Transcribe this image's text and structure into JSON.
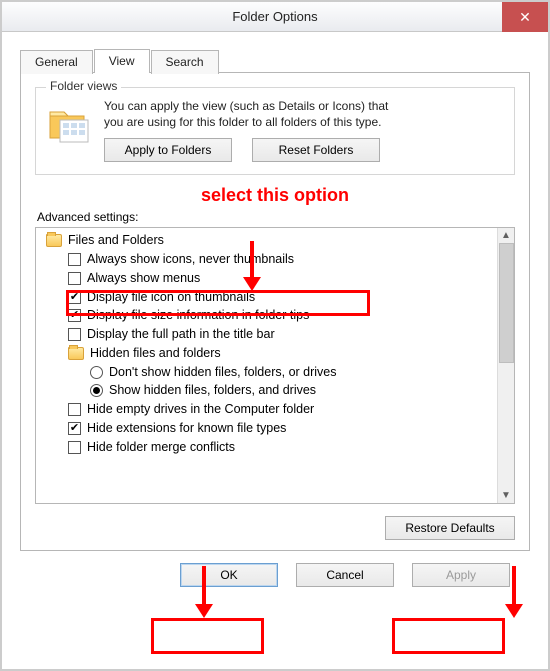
{
  "window": {
    "title": "Folder Options"
  },
  "tabs": {
    "general": "General",
    "view": "View",
    "search": "Search"
  },
  "folder_views": {
    "group": "Folder views",
    "desc1": "You can apply the view (such as Details or Icons) that",
    "desc2": "you are using for this folder to all folders of this type.",
    "apply": "Apply to Folders",
    "reset": "Reset Folders"
  },
  "annotation": {
    "text": "select this option"
  },
  "advanced": {
    "label": "Advanced settings:",
    "root": "Files and Folders",
    "items": [
      {
        "t": "Always show icons, never thumbnails",
        "k": "chk",
        "c": false
      },
      {
        "t": "Always show menus",
        "k": "chk",
        "c": false
      },
      {
        "t": "Display file icon on thumbnails",
        "k": "chk",
        "c": true
      },
      {
        "t": "Display file size information in folder tips",
        "k": "chk",
        "c": true
      },
      {
        "t": "Display the full path in the title bar",
        "k": "chk",
        "c": false
      }
    ],
    "hidden_group": "Hidden files and folders",
    "radios": [
      {
        "t": "Don't show hidden files, folders, or drives",
        "c": false
      },
      {
        "t": "Show hidden files, folders, and drives",
        "c": true
      }
    ],
    "items2": [
      {
        "t": "Hide empty drives in the Computer folder",
        "k": "chk",
        "c": false
      },
      {
        "t": "Hide extensions for known file types",
        "k": "chk",
        "c": true
      },
      {
        "t": "Hide folder merge conflicts",
        "k": "chk",
        "c": false
      }
    ],
    "restore": "Restore Defaults"
  },
  "dialog": {
    "ok": "OK",
    "cancel": "Cancel",
    "apply": "Apply"
  }
}
